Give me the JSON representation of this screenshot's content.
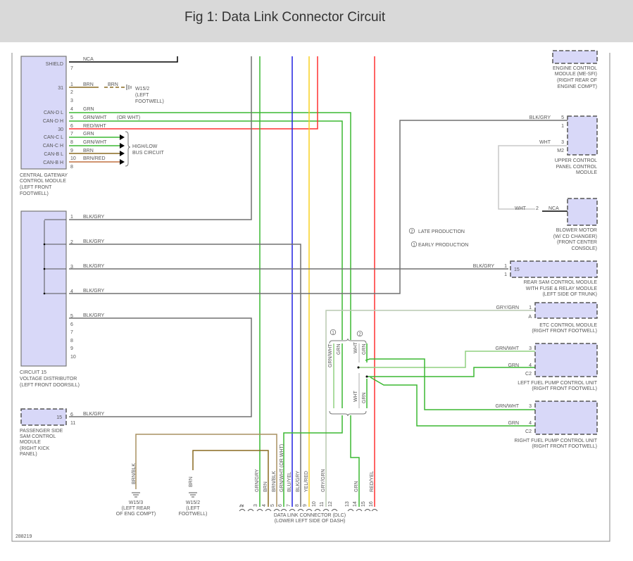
{
  "header": {
    "title": "Fig 1: Data Link Connector Circuit"
  },
  "colors": {
    "grn": "#3cb832",
    "red": "#ff3030",
    "blu": "#2020e0",
    "yel": "#f8d020",
    "brn": "#8a6a20",
    "gry": "#707070",
    "ltgry": "#b8c8b0"
  },
  "cgw": {
    "pin_names": [
      "SHIELD",
      "31",
      "CAN-D L",
      "CAN-D H",
      "30",
      "CAN-C L",
      "CAN-C H",
      "CAN-B L",
      "CAN-B H"
    ],
    "pins": [
      "7",
      "1",
      "2",
      "3",
      "4",
      "5",
      "6",
      "7",
      "8",
      "9",
      "10",
      "8"
    ],
    "wires": [
      "NCA",
      "BRN",
      "BRN",
      "GRN",
      "GRN/WHT",
      "(OR WHT)",
      "RED/WHT",
      "GRN",
      "GRN/WHT",
      "BRN",
      "BRN/RED"
    ],
    "ground": [
      "W15/2",
      "(LEFT",
      "FOOTWELL)"
    ],
    "bus": [
      "HIGH/LOW",
      "BUS CIRCUIT"
    ],
    "name": [
      "CENTRAL GATEWAY",
      "CONTROL MODULE",
      "(LEFT FRONT",
      "FOOTWELL)"
    ]
  },
  "c15": {
    "pins": [
      "1",
      "2",
      "3",
      "4",
      "5",
      "6",
      "7",
      "8",
      "9",
      "10"
    ],
    "wire": "BLK/GRY",
    "name": [
      "CIRCUIT 15",
      "VOLTAGE DISTRIBUTOR",
      "(LEFT FRONT DOORSILL)"
    ]
  },
  "psam": {
    "inner": "15",
    "pins": [
      "6",
      "11"
    ],
    "wire": "BLK/GRY",
    "name": [
      "PASSENGER SIDE",
      "SAM CONTROL",
      "MODULE",
      "(RIGHT KICK",
      "PANEL)"
    ]
  },
  "grounds": [
    {
      "wire": "BRN/BLK",
      "name": [
        "W15/3",
        "(LEFT REAR",
        "OF ENG COMPT)"
      ]
    },
    {
      "wire": "BRN",
      "name": [
        "W15/2",
        "(LEFT",
        "FOOTWELL)"
      ]
    }
  ],
  "dlc": {
    "pins": [
      "1",
      "2",
      "3",
      "4",
      "5",
      "6",
      "7",
      "8",
      "9",
      "10",
      "11",
      "12",
      "13",
      "14",
      "15",
      "16"
    ],
    "wires": [
      "GRN/GRY",
      "BRN",
      "BRN/BLK",
      "GRN/WHT",
      "(OR WHT)",
      "BLU/YEL",
      "BLK/GRY",
      "YEL/RED",
      "GRY/GRN",
      "GRN",
      "RED/YEL"
    ],
    "name": [
      "DATA LINK CONNECTOR (DLC)",
      "(LOWER LEFT SIDE OF DASH)"
    ]
  },
  "ecm": {
    "name": [
      "ENGINE CONTROL",
      "MODULE (ME-SFI)",
      "(RIGHT REAR OF",
      "ENGINE COMPT)"
    ]
  },
  "ucp": {
    "wires": [
      "BLK/GRY",
      "WHT"
    ],
    "pins": [
      "5",
      "1",
      "3",
      "M2"
    ],
    "name": [
      "UPPER CONTROL",
      "PANEL CONTROL",
      "MODULE"
    ]
  },
  "blower": {
    "wire": "WHT",
    "pin": "2",
    "nca": "NCA",
    "name": [
      "BLOWER MOTOR",
      "(W/ CD CHANGER)",
      "(FRONT CENTER",
      "CONSOLE)"
    ]
  },
  "legend": {
    "late": "LATE PRODUCTION",
    "early": "EARLY PRODUCTION",
    "n1": "1",
    "n2": "2"
  },
  "rsam": {
    "wire": "BLK/GRY",
    "pins": [
      "1",
      "1"
    ],
    "inner": "15",
    "name": [
      "REAR SAM CONTROL MODULE",
      "WITH FUSE & RELAY MODULE",
      "(LEFT SIDE OF TRUNK)"
    ]
  },
  "etc": {
    "wire": "GRY/GRN",
    "pins": [
      "1",
      "A"
    ],
    "name": [
      "ETC CONTROL MODULE",
      "(RIGHT FRONT FOOTWELL)"
    ]
  },
  "lfp": {
    "wires": [
      "GRN/WHT",
      "GRN"
    ],
    "pins": [
      "3",
      "4",
      "C2"
    ],
    "name": [
      "LEFT FUEL PUMP CONTROL UNIT",
      "(RIGHT FRONT FOOTWELL)"
    ]
  },
  "rfp": {
    "wires": [
      "GRN/WHT",
      "GRN"
    ],
    "pins": [
      "3",
      "4",
      "C2"
    ],
    "name": [
      "RIGHT FUEL PUMP CONTROL UNIT",
      "(RIGHT FRONT FOOTWELL)"
    ]
  },
  "splice": {
    "wires": [
      "GRN/WHT",
      "GRN",
      "WHT",
      "GRN",
      "WHT",
      "GRN"
    ]
  },
  "figure_id": "288219"
}
